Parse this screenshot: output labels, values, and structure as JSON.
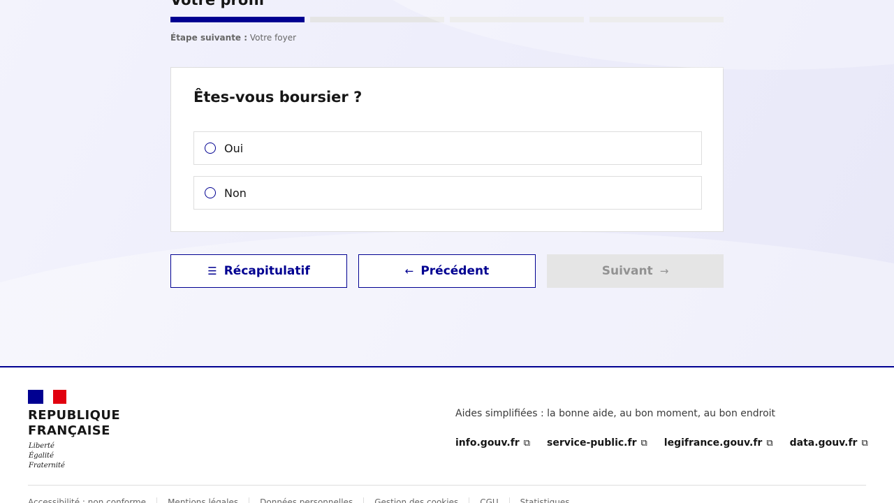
{
  "stepper": {
    "title": "Votre profil",
    "steps_total": 4,
    "current_step": 1,
    "next_label": "Étape suivante :",
    "next_value": "Votre foyer"
  },
  "question": {
    "title": "Êtes-vous boursier ?",
    "options": [
      {
        "label": "Oui",
        "selected": false
      },
      {
        "label": "Non",
        "selected": false
      }
    ]
  },
  "actions": {
    "recap_label": "Récapitulatif",
    "recap_icon": "menu-icon",
    "prev_label": "Précédent",
    "prev_icon": "arrow-left-icon",
    "next_label": "Suivant",
    "next_icon": "arrow-right-icon",
    "next_disabled": true
  },
  "footer": {
    "brand_line1": "REPUBLIQUE",
    "brand_line2": "FRANÇAISE",
    "motto": [
      "Liberté",
      "Égalité",
      "Fraternité"
    ],
    "tagline": "Aides simplifiées : la bonne aide, au bon moment, au bon endroit",
    "links": [
      "info.gouv.fr",
      "service-public.fr",
      "legifrance.gouv.fr",
      "data.gouv.fr"
    ],
    "bottom_links": [
      "Accessibilité : non conforme",
      "Mentions légales",
      "Données personnelles",
      "Gestion des cookies",
      "CGU",
      "Statistiques"
    ]
  },
  "colors": {
    "primary": "#000091",
    "flag_red": "#e1000f",
    "disabled_bg": "#e5e5e5",
    "disabled_text": "#929292"
  }
}
